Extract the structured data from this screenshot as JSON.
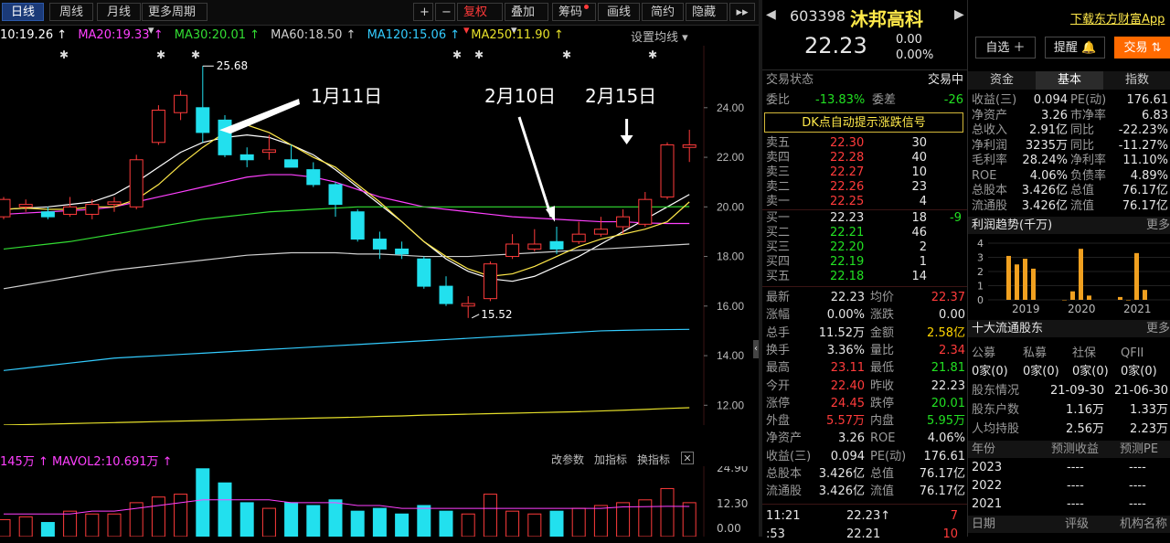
{
  "toolbar": {
    "period_tabs": [
      "日线",
      "周线",
      "月线",
      "更多周期 ▾"
    ],
    "right_buttons": [
      "+",
      "−",
      "复权 ▾",
      "叠加 ▾",
      "筹码",
      "画线",
      "简约",
      "隐藏",
      "▸▸"
    ]
  },
  "ma_legend": {
    "items": [
      {
        "text": "10:19.26 ↑",
        "color": "#ffffff"
      },
      {
        "text": "MA20:19.33 ↑",
        "color": "#ff40ff"
      },
      {
        "text": "MA30:20.01 ↑",
        "color": "#33dd33"
      },
      {
        "text": "MA60:18.50 ↑",
        "color": "#cfcfcf"
      },
      {
        "text": "MA120:15.06 ↑",
        "color": "#33ccff"
      },
      {
        "text": "MA250:11.90 ↑",
        "color": "#e6e02a"
      }
    ],
    "settings_label": "设置均线 ▾"
  },
  "chart_data": {
    "type": "candlestick",
    "y_ticks": [
      "24.00",
      "22.00",
      "20.00",
      "18.00",
      "16.00",
      "14.00",
      "12.00"
    ],
    "y_range": [
      11.2,
      26.5
    ],
    "candles": [
      {
        "o": 19.6,
        "c": 20.3,
        "h": 20.4,
        "l": 19.5
      },
      {
        "o": 20.0,
        "c": 20.1,
        "h": 20.3,
        "l": 19.8
      },
      {
        "o": 19.8,
        "c": 19.6,
        "h": 20.0,
        "l": 19.5
      },
      {
        "o": 19.7,
        "c": 20.0,
        "h": 20.4,
        "l": 19.6
      },
      {
        "o": 19.7,
        "c": 20.1,
        "h": 20.3,
        "l": 19.5
      },
      {
        "o": 20.1,
        "c": 20.2,
        "h": 20.4,
        "l": 19.8
      },
      {
        "o": 20.0,
        "c": 21.9,
        "h": 22.1,
        "l": 19.9
      },
      {
        "o": 22.6,
        "c": 23.9,
        "h": 24.1,
        "l": 22.5
      },
      {
        "o": 23.8,
        "c": 24.5,
        "h": 24.7,
        "l": 23.5
      },
      {
        "o": 24.0,
        "c": 23.0,
        "h": 25.68,
        "l": 22.6
      },
      {
        "o": 23.5,
        "c": 22.1,
        "h": 23.7,
        "l": 22.0
      },
      {
        "o": 22.1,
        "c": 21.9,
        "h": 22.4,
        "l": 21.6
      },
      {
        "o": 22.2,
        "c": 22.3,
        "h": 22.9,
        "l": 21.9
      },
      {
        "o": 21.9,
        "c": 21.6,
        "h": 22.5,
        "l": 21.6
      },
      {
        "o": 21.5,
        "c": 20.9,
        "h": 21.8,
        "l": 20.8
      },
      {
        "o": 20.9,
        "c": 20.1,
        "h": 21.0,
        "l": 19.6
      },
      {
        "o": 19.8,
        "c": 18.7,
        "h": 19.9,
        "l": 18.6
      },
      {
        "o": 18.7,
        "c": 18.3,
        "h": 19.0,
        "l": 17.9
      },
      {
        "o": 18.3,
        "c": 18.1,
        "h": 18.6,
        "l": 17.9
      },
      {
        "o": 17.9,
        "c": 16.8,
        "h": 18.0,
        "l": 16.7
      },
      {
        "o": 16.8,
        "c": 16.1,
        "h": 17.2,
        "l": 16.0
      },
      {
        "o": 16.0,
        "c": 16.1,
        "h": 16.4,
        "l": 15.52
      },
      {
        "o": 16.3,
        "c": 17.7,
        "h": 17.8,
        "l": 16.2
      },
      {
        "o": 18.0,
        "c": 18.5,
        "h": 18.9,
        "l": 17.9
      },
      {
        "o": 18.3,
        "c": 18.5,
        "h": 19.1,
        "l": 18.2
      },
      {
        "o": 18.6,
        "c": 18.3,
        "h": 19.2,
        "l": 18.1
      },
      {
        "o": 18.6,
        "c": 18.9,
        "h": 19.4,
        "l": 18.5
      },
      {
        "o": 18.9,
        "c": 19.1,
        "h": 19.6,
        "l": 18.8
      },
      {
        "o": 19.2,
        "c": 19.6,
        "h": 19.9,
        "l": 18.9
      },
      {
        "o": 19.3,
        "c": 20.3,
        "h": 20.6,
        "l": 19.2
      },
      {
        "o": 20.4,
        "c": 22.5,
        "h": 22.6,
        "l": 20.3
      },
      {
        "o": 22.4,
        "c": 22.5,
        "h": 23.11,
        "l": 21.81
      }
    ],
    "ma_lines": [
      {
        "name": "MA10",
        "color": "#ffffff",
        "values": [
          19.9,
          19.95,
          20.0,
          20.1,
          20.2,
          20.5,
          21.0,
          21.6,
          22.2,
          22.6,
          22.8,
          22.9,
          22.8,
          22.5,
          22.1,
          21.5,
          20.8,
          20.1,
          19.4,
          18.6,
          17.9,
          17.4,
          17.1,
          17.0,
          17.2,
          17.6,
          18.0,
          18.5,
          19.0,
          19.5,
          20.0,
          20.5
        ]
      },
      {
        "name": "MA20",
        "color": "#ff40ff",
        "values": [
          19.7,
          19.75,
          19.8,
          19.85,
          19.9,
          20.0,
          20.2,
          20.4,
          20.6,
          20.8,
          21.0,
          21.2,
          21.3,
          21.3,
          21.2,
          21.0,
          20.7,
          20.4,
          20.2,
          20.0,
          19.9,
          19.8,
          19.7,
          19.6,
          19.55,
          19.5,
          19.45,
          19.4,
          19.4,
          19.35,
          19.33,
          19.33
        ]
      },
      {
        "name": "MA30",
        "color": "#33dd33",
        "values": [
          18.3,
          18.4,
          18.5,
          18.6,
          18.75,
          18.9,
          19.05,
          19.2,
          19.35,
          19.5,
          19.6,
          19.7,
          19.8,
          19.85,
          19.9,
          19.95,
          20.0,
          20.0,
          20.0,
          20.0,
          20.0,
          20.0,
          20.0,
          20.0,
          20.0,
          20.0,
          20.0,
          20.0,
          20.0,
          20.0,
          20.0,
          20.01
        ]
      },
      {
        "name": "MA60",
        "color": "#cfcfcf",
        "values": [
          16.7,
          16.85,
          17.0,
          17.15,
          17.3,
          17.45,
          17.55,
          17.65,
          17.75,
          17.85,
          17.95,
          18.05,
          18.1,
          18.15,
          18.15,
          18.15,
          18.1,
          18.1,
          18.05,
          18.0,
          18.0,
          18.0,
          18.05,
          18.1,
          18.15,
          18.2,
          18.25,
          18.3,
          18.35,
          18.4,
          18.45,
          18.5
        ]
      },
      {
        "name": "MA250",
        "color": "#e6e02a",
        "values": [
          11.2,
          11.22,
          11.24,
          11.26,
          11.28,
          11.3,
          11.32,
          11.34,
          11.36,
          11.38,
          11.4,
          11.42,
          11.44,
          11.46,
          11.48,
          11.5,
          11.52,
          11.55,
          11.57,
          11.6,
          11.62,
          11.64,
          11.66,
          11.68,
          11.7,
          11.72,
          11.74,
          11.77,
          11.8,
          11.83,
          11.87,
          11.9
        ]
      },
      {
        "name": "MA120",
        "color": "#33ccff",
        "values": [
          13.4,
          13.5,
          13.6,
          13.7,
          13.8,
          13.9,
          13.95,
          14.0,
          14.05,
          14.1,
          14.15,
          14.2,
          14.25,
          14.3,
          14.35,
          14.4,
          14.45,
          14.5,
          14.55,
          14.6,
          14.65,
          14.7,
          14.75,
          14.8,
          14.85,
          14.9,
          14.95,
          15.0,
          15.02,
          15.04,
          15.05,
          15.06
        ]
      },
      {
        "name": "MA5",
        "color": "#ffe94a",
        "values": [
          19.9,
          19.95,
          19.9,
          19.9,
          20.0,
          20.0,
          20.3,
          20.9,
          21.7,
          22.4,
          23.0,
          23.3,
          23.0,
          22.5,
          22.0,
          21.6,
          20.9,
          20.2,
          19.4,
          18.6,
          18.0,
          17.5,
          17.2,
          17.3,
          17.6,
          18.0,
          18.4,
          18.7,
          18.9,
          19.1,
          19.4,
          20.2
        ]
      }
    ],
    "annotations": [
      {
        "text": "1月11日"
      },
      {
        "text": "2月10日"
      },
      {
        "text": "2月15日"
      },
      {
        "text": "25.68"
      },
      {
        "text": "15.52"
      }
    ],
    "vol_legend": "145万 ↑  MAVOL2:10.691万 ↑",
    "vol_ticks": [
      "24.90",
      "12.30",
      "0.00"
    ],
    "vol_tools": [
      "改参数",
      "加指标",
      "换指标"
    ],
    "volumes": [
      6,
      7,
      5,
      9,
      8,
      8,
      12,
      14,
      15,
      24,
      19,
      12,
      10,
      12,
      11,
      13,
      9,
      10,
      8,
      11,
      9,
      8,
      15,
      9,
      8,
      9,
      10,
      11,
      12,
      13,
      17,
      12
    ]
  },
  "quote": {
    "code": "603398",
    "name": "沐邦高科",
    "download_link": "下载东方财富App",
    "price": "22.23",
    "change": "0.00",
    "change_pct": "0.00%",
    "btn_watchlist": "自选 ＋",
    "btn_alert": "提醒 🔔",
    "btn_trade": "交易 ⇅",
    "status_label": "交易状态",
    "status_value": "交易中",
    "weibi_label": "委比",
    "weibi_value": "-13.83%",
    "weicha_label": "委差",
    "weicha_value": "-26",
    "dk_banner": "DK点自动提示涨跌信号",
    "asks": [
      {
        "label": "卖五",
        "price": "22.30",
        "vol": "30"
      },
      {
        "label": "卖四",
        "price": "22.28",
        "vol": "40"
      },
      {
        "label": "卖三",
        "price": "22.27",
        "vol": "10"
      },
      {
        "label": "卖二",
        "price": "22.26",
        "vol": "23"
      },
      {
        "label": "卖一",
        "price": "22.25",
        "vol": "4"
      }
    ],
    "bids": [
      {
        "label": "买一",
        "price": "22.23",
        "vol": "18",
        "chg": "-9"
      },
      {
        "label": "买二",
        "price": "22.21",
        "vol": "46",
        "chg": ""
      },
      {
        "label": "买三",
        "price": "22.20",
        "vol": "2",
        "chg": ""
      },
      {
        "label": "买四",
        "price": "22.19",
        "vol": "1",
        "chg": ""
      },
      {
        "label": "买五",
        "price": "22.18",
        "vol": "14",
        "chg": ""
      }
    ],
    "stats": [
      {
        "l1": "最新",
        "v1": "22.23",
        "c1": "white",
        "l2": "均价",
        "v2": "22.37",
        "c2": "red"
      },
      {
        "l1": "涨幅",
        "v1": "0.00%",
        "c1": "white",
        "l2": "涨跌",
        "v2": "0.00",
        "c2": "white"
      },
      {
        "l1": "总手",
        "v1": "11.52万",
        "c1": "white",
        "l2": "金额",
        "v2": "2.58亿",
        "c2": "yellow"
      },
      {
        "l1": "换手",
        "v1": "3.36%",
        "c1": "white",
        "l2": "量比",
        "v2": "2.34",
        "c2": "red"
      },
      {
        "l1": "最高",
        "v1": "23.11",
        "c1": "red",
        "l2": "最低",
        "v2": "21.81",
        "c2": "green"
      },
      {
        "l1": "今开",
        "v1": "22.40",
        "c1": "red",
        "l2": "昨收",
        "v2": "22.23",
        "c2": "white"
      },
      {
        "l1": "涨停",
        "v1": "24.45",
        "c1": "red",
        "l2": "跌停",
        "v2": "20.01",
        "c2": "green"
      },
      {
        "l1": "外盘",
        "v1": "5.57万",
        "c1": "red",
        "l2": "内盘",
        "v2": "5.95万",
        "c2": "green"
      },
      {
        "l1": "净资产",
        "v1": "3.26",
        "c1": "white",
        "l2": "ROE",
        "v2": "4.06%",
        "c2": "white"
      },
      {
        "l1": "收益(三)",
        "v1": "0.094",
        "c1": "white",
        "l2": "PE(动)",
        "v2": "176.61",
        "c2": "white"
      },
      {
        "l1": "总股本",
        "v1": "3.426亿",
        "c1": "white",
        "l2": "总值",
        "v2": "76.17亿",
        "c2": "white"
      },
      {
        "l1": "流通股",
        "v1": "3.426亿",
        "c1": "white",
        "l2": "流值",
        "v2": "76.17亿",
        "c2": "white"
      }
    ],
    "tick": {
      "time": "11:21",
      "price": "22.23↑",
      "vol": "7",
      "time2": ":53",
      "price2": "22.21",
      "vol2": "10"
    }
  },
  "fund": {
    "tabs": [
      "资金",
      "基本",
      "指数"
    ],
    "rows": [
      {
        "l1": "收益(三)",
        "v1": "0.094",
        "l2": "PE(动)",
        "v2": "176.61"
      },
      {
        "l1": "净资产",
        "v1": "3.26",
        "l2": "市净率",
        "v2": "6.83"
      },
      {
        "l1": "总收入",
        "v1": "2.91亿",
        "l2": "同比",
        "v2": "-22.23%"
      },
      {
        "l1": "净利润",
        "v1": "3235万",
        "l2": "同比",
        "v2": "-11.27%"
      },
      {
        "l1": "毛利率",
        "v1": "28.24%",
        "l2": "净利率",
        "v2": "11.10%"
      },
      {
        "l1": "ROE",
        "v1": "4.06%",
        "l2": "负债率",
        "v2": "4.89%"
      },
      {
        "l1": "总股本",
        "v1": "3.426亿",
        "l2": "总值",
        "v2": "76.17亿"
      },
      {
        "l1": "流通股",
        "v1": "3.426亿",
        "l2": "流值",
        "v2": "76.17亿"
      }
    ],
    "profit_title": "利润趋势(千万)",
    "more": "更多",
    "profit_chart": {
      "type": "bar",
      "y_ticks": [
        "4",
        "3",
        "2",
        "1",
        "0"
      ],
      "x_labels": [
        "2019",
        "2020",
        "2021"
      ],
      "values": [
        3.1,
        2.5,
        2.9,
        2.2,
        0.0,
        0.6,
        3.6,
        0.3,
        0.2,
        0.0,
        3.3,
        0.7
      ]
    },
    "holders_title": "十大流通股东",
    "holder_cols": [
      "公募",
      "私募",
      "社保",
      "QFII"
    ],
    "holder_vals": [
      "0家(0)",
      "0家(0)",
      "0家(0)",
      "0家(0)"
    ],
    "holder_rows": [
      {
        "l": "股东情况",
        "a": "21-09-30",
        "b": "21-06-30"
      },
      {
        "l": "股东户数",
        "a": "1.16万",
        "b": "1.33万"
      },
      {
        "l": "人均持股",
        "a": "2.56万",
        "b": "2.23万"
      }
    ],
    "forecast_cols": [
      "年份",
      "预测收益",
      "预测PE"
    ],
    "forecast_rows": [
      {
        "y": "2023",
        "a": "----",
        "b": "----"
      },
      {
        "y": "2022",
        "a": "----",
        "b": "----"
      },
      {
        "y": "2021",
        "a": "----",
        "b": "----"
      }
    ],
    "rating_cols": [
      "日期",
      "评级",
      "机构名称"
    ]
  }
}
